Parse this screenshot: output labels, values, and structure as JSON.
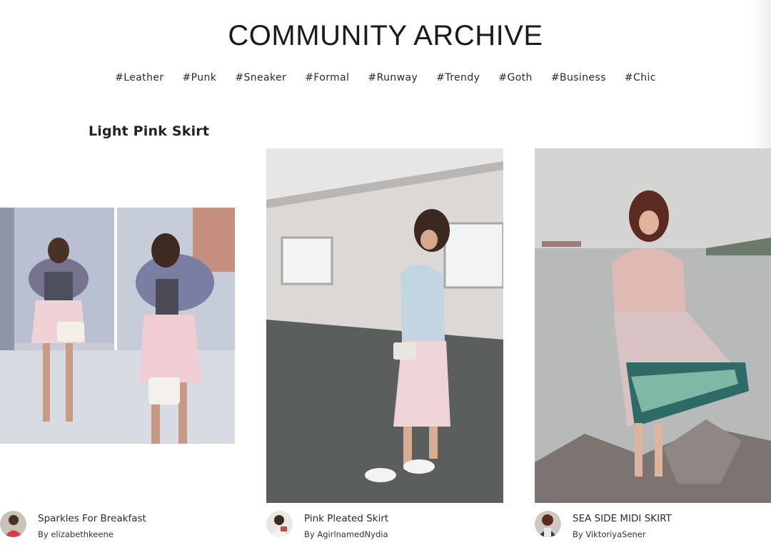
{
  "header": {
    "title": "COMMUNITY ARCHIVE",
    "tags": [
      "#Leather",
      "#Punk",
      "#Sneaker",
      "#Formal",
      "#Runway",
      "#Trendy",
      "#Goth",
      "#Business",
      "#Chic"
    ]
  },
  "section": {
    "title": "Light Pink Skirt"
  },
  "posts": [
    {
      "title": "Sparkles For Breakfast",
      "byline": "By elizabethkeene"
    },
    {
      "title": "Pink Pleated Skirt",
      "byline": "By AgirlnamedNydia"
    },
    {
      "title": "SEA SIDE MIDI SKIRT",
      "byline": "By ViktoriyaSener"
    }
  ]
}
